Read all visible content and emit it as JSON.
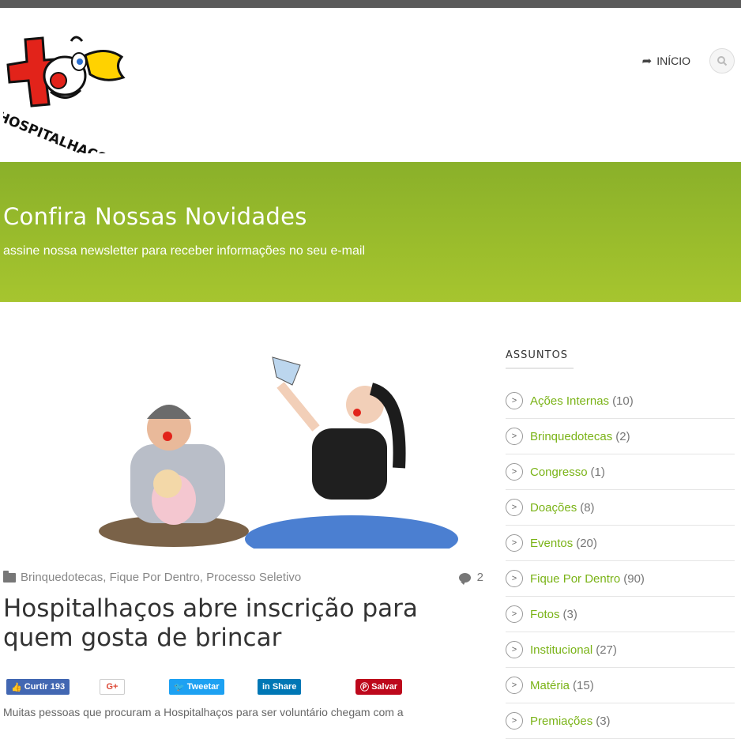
{
  "nav": {
    "home_label": "INÍCIO",
    "home_icon": "share-arrow-icon",
    "search_icon": "search-icon"
  },
  "logo": {
    "text": "HOSPITALHAÇOS"
  },
  "banner": {
    "title": "Confira Nossas Novidades",
    "subtitle": "assine nossa newsletter para receber informações no seu e-mail"
  },
  "post": {
    "categories": "Brinquedotecas, Fique Por Dentro, Processo Seletivo",
    "comment_count": "2",
    "title": "Hospitalhaços abre inscrição para quem gosta de brincar",
    "excerpt": "Muitas pessoas que procuram a Hospitalhaços para ser voluntário chegam com a"
  },
  "share": {
    "facebook": "Curtir 193",
    "google": "G+",
    "twitter": "Tweetar",
    "linkedin": "Share",
    "pinterest": "Salvar"
  },
  "sidebar": {
    "heading": "ASSUNTOS",
    "categories": [
      {
        "name": "Ações Internas",
        "count": "(10)"
      },
      {
        "name": "Brinquedotecas",
        "count": "(2)"
      },
      {
        "name": "Congresso",
        "count": "(1)"
      },
      {
        "name": "Doações",
        "count": "(8)"
      },
      {
        "name": "Eventos",
        "count": "(20)"
      },
      {
        "name": "Fique Por Dentro",
        "count": "(90)"
      },
      {
        "name": "Fotos",
        "count": "(3)"
      },
      {
        "name": "Institucional",
        "count": "(27)"
      },
      {
        "name": "Matéria",
        "count": "(15)"
      },
      {
        "name": "Premiações",
        "count": "(3)"
      }
    ]
  },
  "colors": {
    "accent": "#7ab317",
    "banner": "#9bbd2c"
  }
}
